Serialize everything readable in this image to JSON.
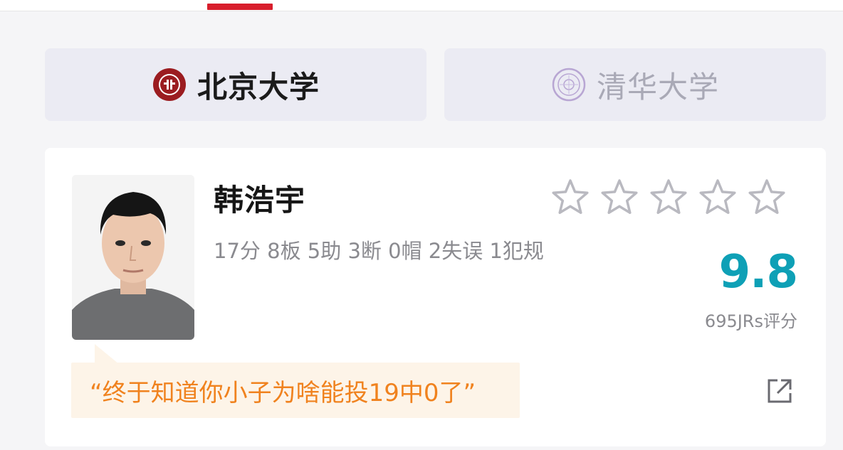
{
  "tabs": {
    "home_team": {
      "name": "北京大学",
      "logo_icon": "peking-university-logo-icon",
      "logo_color": "#9b1c20"
    },
    "away_team": {
      "name": "清华大学",
      "logo_icon": "tsinghua-university-logo-icon",
      "logo_color": "#7b5ea7"
    },
    "active_indicator_color": "#d81e2c"
  },
  "player": {
    "name": "韩浩宇",
    "stats_line": "17分 8板 5助 3断 0帽 2失误 1犯规",
    "photo_icon": "player-photo",
    "rating": {
      "stars_filled": 0,
      "stars_total": 5,
      "score": "9.8",
      "count_text": "695JRs评分",
      "score_color": "#0ea0b6"
    },
    "comment": {
      "text": "“终于知道你小子为啥能投19中0了”",
      "text_color": "#f0821e",
      "bubble_color": "#fdf4e8"
    },
    "share_icon": "share-external-icon"
  }
}
